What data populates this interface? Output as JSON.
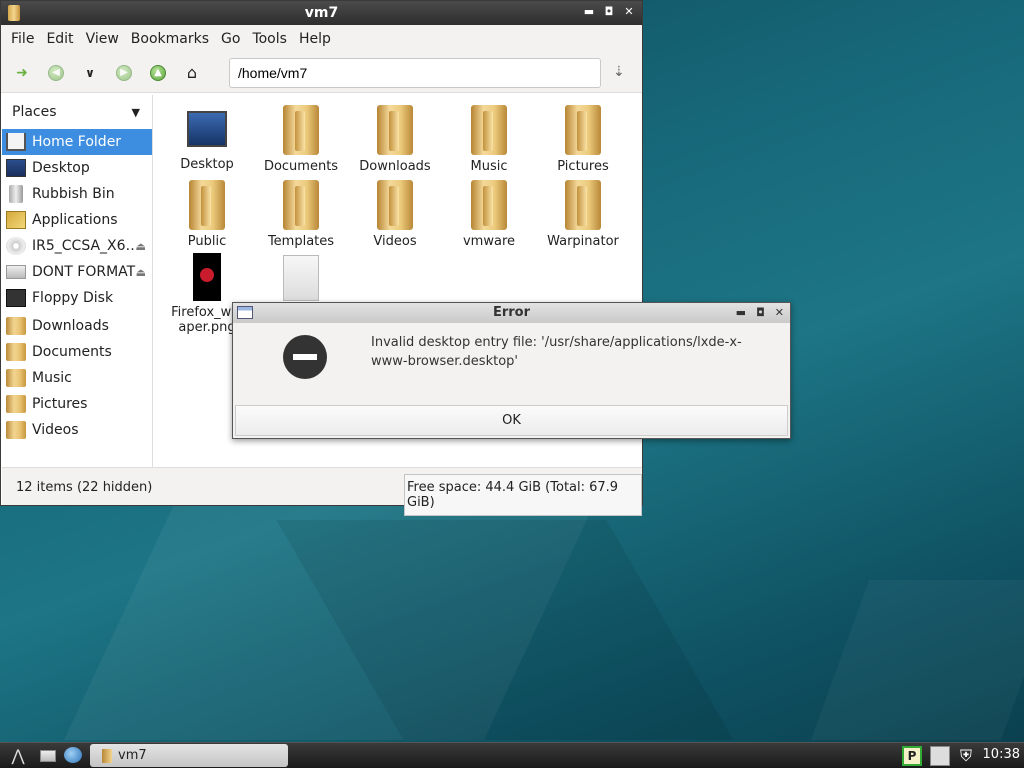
{
  "window": {
    "title": "vm7",
    "menu": [
      "File",
      "Edit",
      "View",
      "Bookmarks",
      "Go",
      "Tools",
      "Help"
    ],
    "path": "/home/vm7"
  },
  "sidebar": {
    "header": "Places",
    "items": [
      {
        "label": "Home Folder",
        "icon": "home-icon",
        "active": true
      },
      {
        "label": "Desktop",
        "icon": "desktop-icon"
      },
      {
        "label": "Rubbish Bin",
        "icon": "trash-icon"
      },
      {
        "label": "Applications",
        "icon": "applications-icon"
      },
      {
        "label": "IR5_CCSA_X6…",
        "icon": "disc-icon",
        "eject": true
      },
      {
        "label": "DONT FORMAT",
        "icon": "drive-icon",
        "eject": true
      },
      {
        "label": "Floppy Disk",
        "icon": "floppy-icon"
      },
      {
        "label": "Downloads",
        "icon": "folder-icon"
      },
      {
        "label": "Documents",
        "icon": "folder-icon"
      },
      {
        "label": "Music",
        "icon": "folder-icon"
      },
      {
        "label": "Pictures",
        "icon": "folder-icon"
      },
      {
        "label": "Videos",
        "icon": "folder-icon"
      }
    ]
  },
  "files": [
    {
      "name": "Desktop",
      "type": "desktop"
    },
    {
      "name": "Documents",
      "type": "folder"
    },
    {
      "name": "Downloads",
      "type": "folder"
    },
    {
      "name": "Music",
      "type": "folder"
    },
    {
      "name": "Pictures",
      "type": "folder"
    },
    {
      "name": "Public",
      "type": "folder"
    },
    {
      "name": "Templates",
      "type": "folder"
    },
    {
      "name": "Videos",
      "type": "folder"
    },
    {
      "name": "vmware",
      "type": "folder"
    },
    {
      "name": "Warpinator",
      "type": "folder"
    },
    {
      "name": "Firefox_wal",
      "name2": "aper.png",
      "type": "image"
    },
    {
      "name": "",
      "type": "document"
    }
  ],
  "status": {
    "items": "12 items (22 hidden)",
    "free": "Free space: 44.4 GiB (Total: 67.9 GiB)"
  },
  "dialog": {
    "title": "Error",
    "message": "Invalid desktop entry file: '/usr/share/applications/lxde-x-www-browser.desktop'",
    "ok": "OK"
  },
  "taskbar": {
    "task": "vm7",
    "clock": "10:38"
  }
}
